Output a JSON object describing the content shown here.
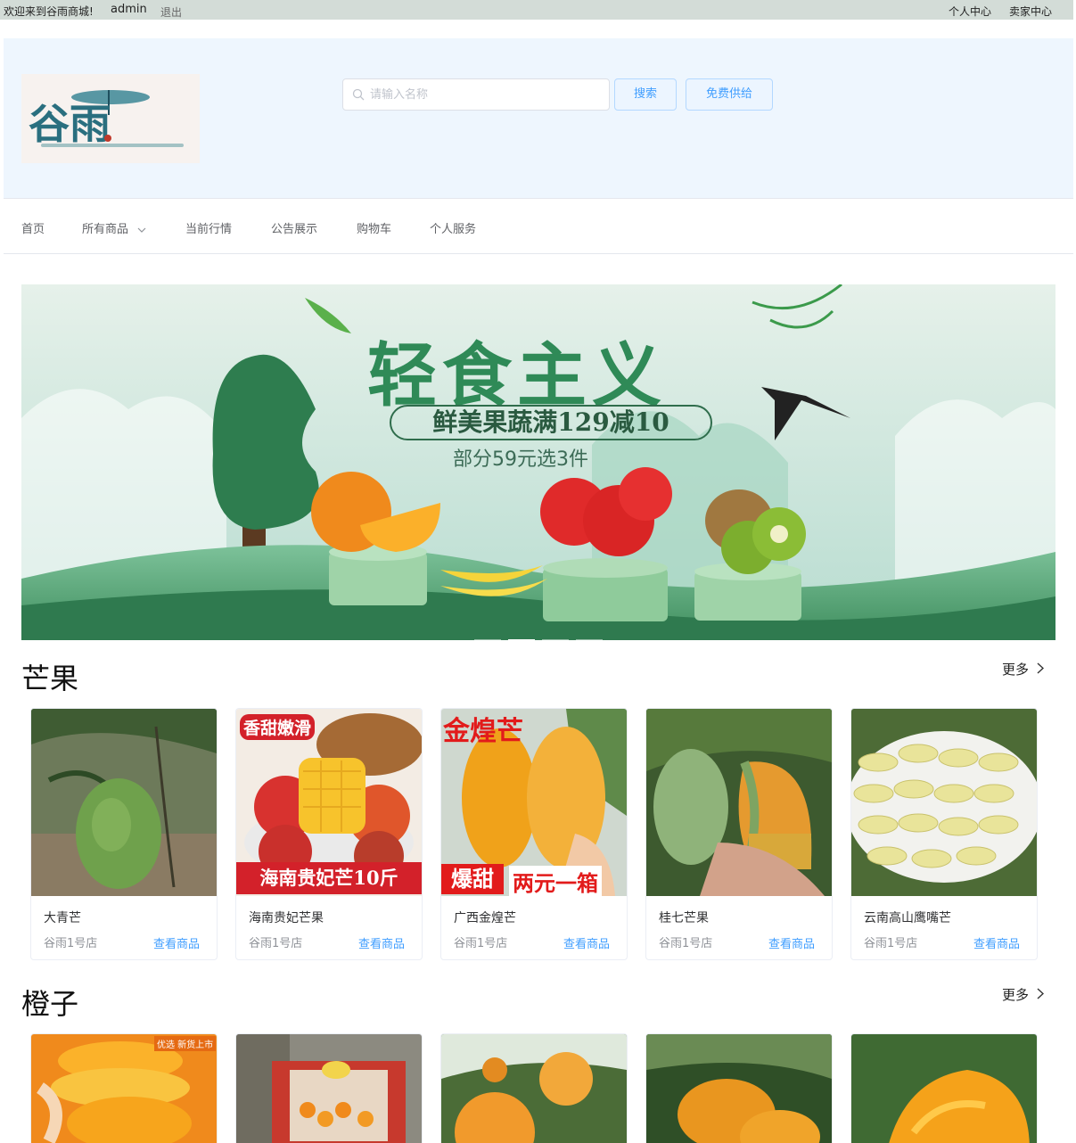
{
  "topbar": {
    "welcome": "欢迎来到谷雨商城!",
    "username": "admin",
    "logout": "退出",
    "personal_center": "个人中心",
    "seller_center": "卖家中心"
  },
  "header": {
    "logo_text": "谷雨",
    "search_placeholder": "请输入名称",
    "search_button": "搜索",
    "supply_button": "免费供给"
  },
  "nav": {
    "items": [
      "首页",
      "所有商品",
      "当前行情",
      "公告展示",
      "购物车",
      "个人服务"
    ]
  },
  "banner": {
    "title": "轻食主义",
    "subtitle": "鲜美果蔬满129减10",
    "subtitle2": "部分59元选3件",
    "slide_count": 4,
    "active_slide": 2
  },
  "sections": [
    {
      "title": "芒果",
      "more": "更多",
      "products": [
        {
          "name": "大青芒",
          "shop": "谷雨1号店",
          "action": "查看商品"
        },
        {
          "name": "海南贵妃芒果",
          "shop": "谷雨1号店",
          "action": "查看商品",
          "img_text_top": "香甜嫩滑",
          "img_text_bottom": "海南贵妃芒10斤"
        },
        {
          "name": "广西金煌芒",
          "shop": "谷雨1号店",
          "action": "查看商品",
          "img_text_top": "金煌芒",
          "img_text_bottom_1": "爆甜",
          "img_text_bottom_2": "两元一箱"
        },
        {
          "name": "桂七芒果",
          "shop": "谷雨1号店",
          "action": "查看商品"
        },
        {
          "name": "云南高山鹰嘴芒",
          "shop": "谷雨1号店",
          "action": "查看商品"
        }
      ]
    },
    {
      "title": "橙子",
      "more": "更多",
      "products": [
        {
          "img_text": "优选 新货上市"
        },
        {},
        {},
        {},
        {}
      ]
    }
  ],
  "colors": {
    "accent": "#409eff",
    "header_bg": "#eef6fe",
    "topbar_bg": "#d3dcd7"
  }
}
